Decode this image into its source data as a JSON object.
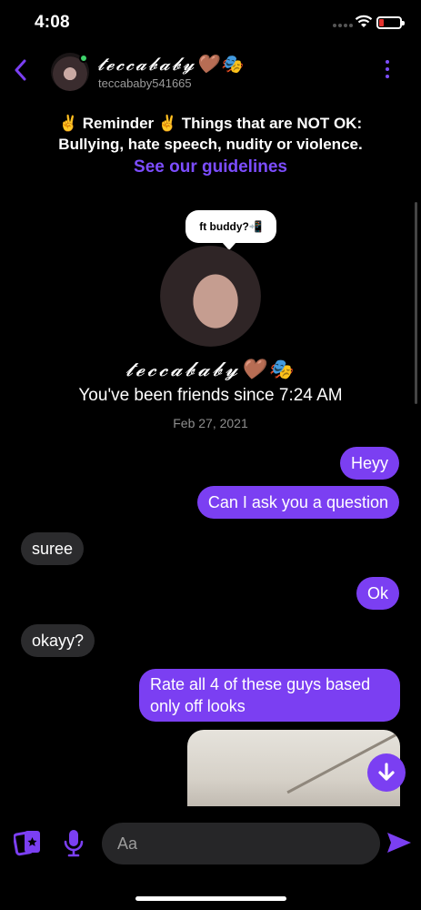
{
  "status_bar": {
    "time": "4:08"
  },
  "header": {
    "contact_name": "𝓽𝓮𝓬𝓬𝓪𝓫𝓪𝓫𝔂🤎🎭",
    "contact_username": "teccababy541665",
    "online_color": "#3ed36b"
  },
  "reminder": {
    "line1": "✌️ Reminder ✌️ Things that are NOT OK:",
    "line2": "Bullying, hate speech, nudity or violence.",
    "guidelines_link": "See our guidelines"
  },
  "profile": {
    "note": "ft buddy?📲",
    "name": "𝓽𝓮𝓬𝓬𝓪𝓫𝓪𝓫𝔂🤎🎭",
    "friends_since": "You've been friends since 7:24 AM",
    "date": "Feb 27, 2021"
  },
  "messages": [
    {
      "direction": "out",
      "text": "Heyy"
    },
    {
      "direction": "out",
      "text": "Can I ask you a question"
    },
    {
      "direction": "in",
      "text": "suree"
    },
    {
      "direction": "out",
      "text": "Ok"
    },
    {
      "direction": "in",
      "text": "okayy?"
    },
    {
      "direction": "out",
      "text": "Rate all 4 of these guys based only off looks"
    }
  ],
  "composer": {
    "placeholder": "Aa"
  },
  "colors": {
    "accent": "#7b3ff2",
    "incoming_bubble": "#2b2b2d",
    "background": "#000000"
  },
  "icons": {
    "back": "chevron-left-icon",
    "more": "more-vertical-icon",
    "camera": "camera-roll-icon",
    "mic": "microphone-icon",
    "send": "send-icon",
    "jump": "arrow-down-icon"
  }
}
